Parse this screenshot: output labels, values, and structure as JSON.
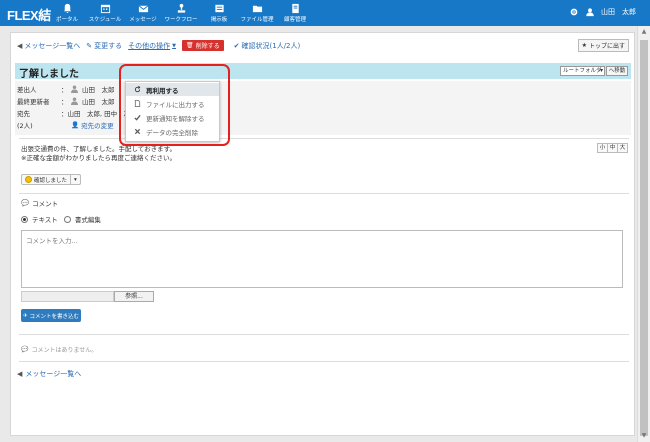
{
  "header": {
    "logo": "FLEX結",
    "nav": [
      {
        "label": "ポータル",
        "icon": "bell-icon"
      },
      {
        "label": "スケジュール",
        "icon": "calendar-icon"
      },
      {
        "label": "メッセージ",
        "icon": "envelope-icon"
      },
      {
        "label": "ワークフロー",
        "icon": "workflow-icon"
      },
      {
        "label": "掲示板",
        "icon": "board-icon"
      },
      {
        "label": "ファイル管理",
        "icon": "folder-icon"
      },
      {
        "label": "顧客管理",
        "icon": "customer-icon"
      }
    ],
    "user_name": "山田　太郎"
  },
  "toolbar": {
    "back_label": "メッセージ一覧へ",
    "edit_label": "変更する",
    "other_ops_label": "その他の操作",
    "delete_label": "削除する",
    "confirm_status": "確認状況(1人/2人)",
    "to_top_label": "トップに出す"
  },
  "message": {
    "title": "了解しました",
    "folder_select": "ルートフォルダ",
    "move_label": "へ移動",
    "sender_key": "差出人",
    "sender": "山田　太郎",
    "updater_key": "最終更新者",
    "updater": "山田　太郎",
    "to_key": "宛先",
    "to": "山田　太郎, 田中　次郎",
    "count": "(2人)",
    "change_to_label": "宛先の変更",
    "body_line1": "出張交通費の件、了解しました。手配しておきます。",
    "body_line2": "※正確な金額がわかりましたら再度ご連絡ください。",
    "size_buttons": [
      "小",
      "中",
      "大"
    ],
    "confirmed_label": "確認しました"
  },
  "dropdown": {
    "items": [
      {
        "label": "再利用する",
        "icon": "refresh-icon"
      },
      {
        "label": "ファイルに出力する",
        "icon": "file-icon"
      },
      {
        "label": "更新通知を解除する",
        "icon": "check-icon"
      },
      {
        "label": "データの完全削除",
        "icon": "x-icon"
      }
    ]
  },
  "comment": {
    "heading": "コメント",
    "radio_text": "テキスト",
    "radio_rich": "書式編集",
    "placeholder": "コメントを入力...",
    "browse_label": "参照...",
    "post_label": "コメントを書き込む",
    "empty_label": "コメントはありません。"
  },
  "footer": {
    "back_label": "メッセージ一覧へ"
  },
  "colors": {
    "header_bg": "#1878c8",
    "title_bg": "#bde5ef",
    "delete_red": "#d7312e",
    "highlight_red": "#e5201d",
    "primary_button": "#2e7cbf"
  }
}
